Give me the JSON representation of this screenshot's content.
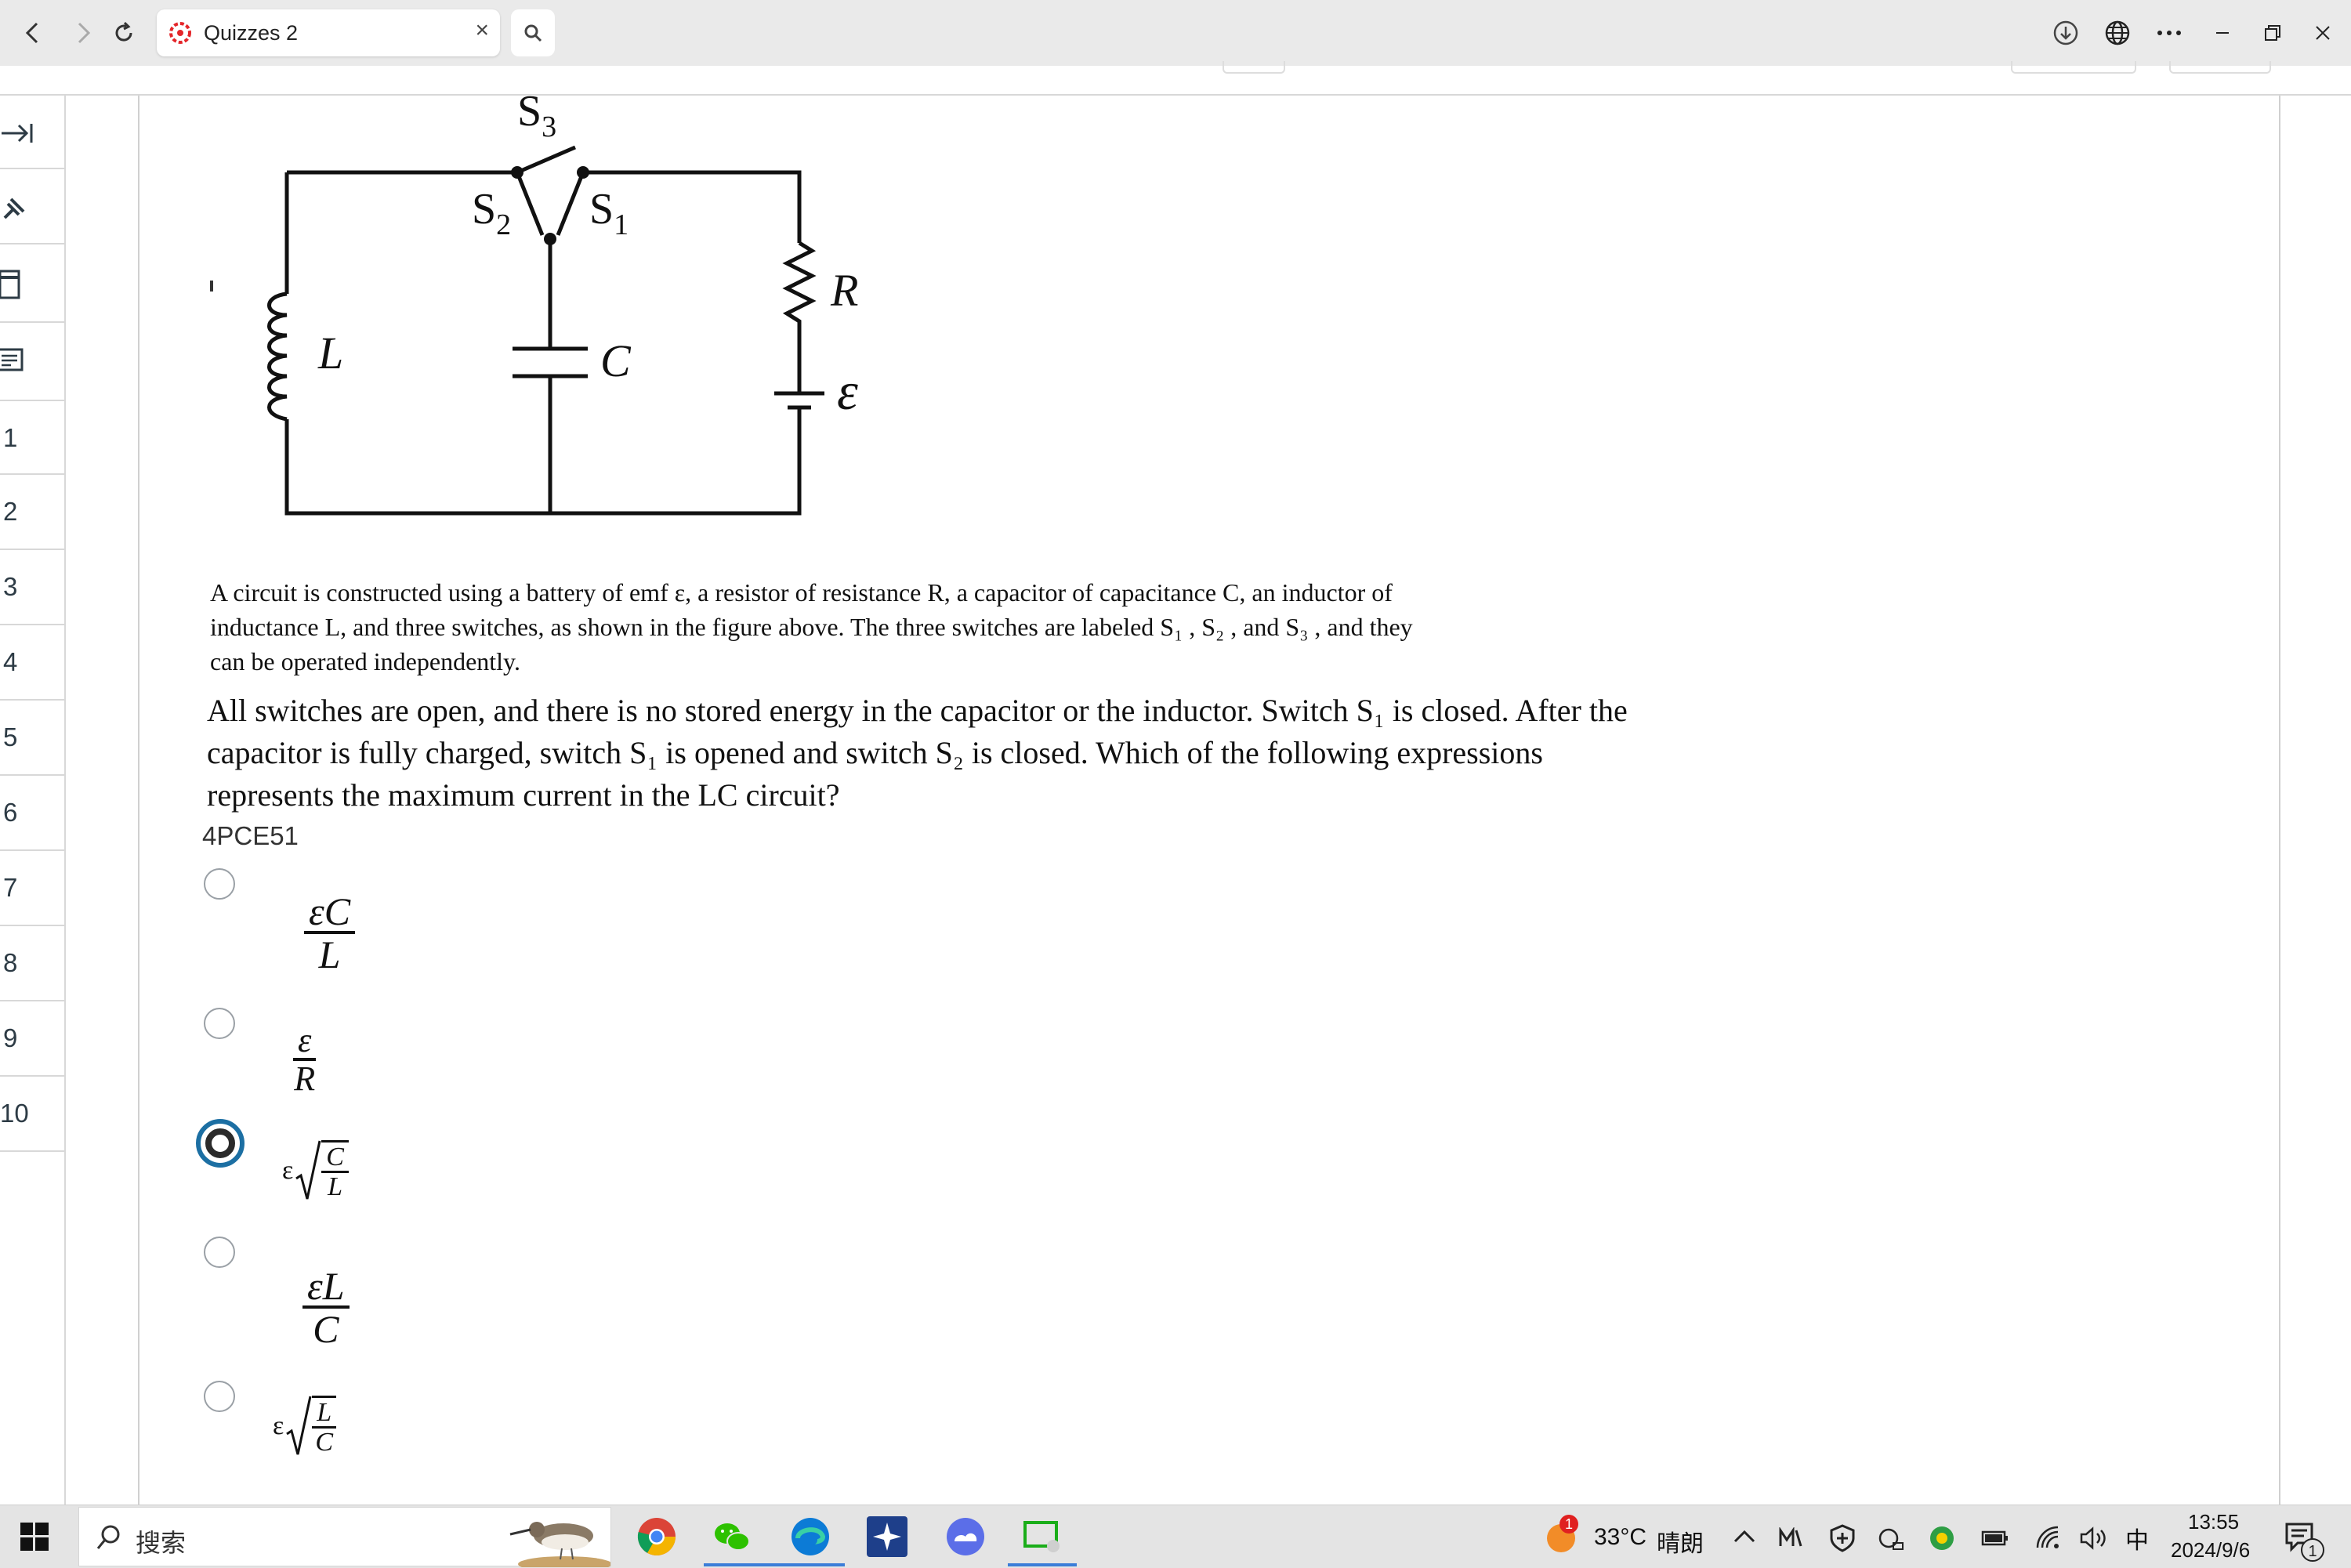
{
  "browser": {
    "tab_title": "Quizzes 2",
    "tab_close": "×"
  },
  "sidebar": {
    "numbers": [
      "1",
      "2",
      "3",
      "4",
      "5",
      "6",
      "7",
      "8",
      "9",
      "10"
    ]
  },
  "figure": {
    "labels": {
      "s1": "S",
      "s1_sub": "1",
      "s2": "S",
      "s2_sub": "2",
      "s3": "S",
      "s3_sub": "3",
      "inductor": "L",
      "capacitor": "C",
      "resistor": "R",
      "emf": "ε"
    }
  },
  "question": {
    "intro_lines": [
      "A circuit is constructed using a battery of emf ε, a resistor of resistance R, a capacitor of capacitance C, an inductor of",
      "inductance L, and three switches, as shown in the figure above. The three switches are labeled S₁ , S₂ , and S₃ , and they",
      "can be operated independently."
    ],
    "body_lines": [
      "All switches are open, and there is no stored energy in the capacitor or the inductor. Switch S₁ is closed. After the",
      "capacitor is fully charged, switch S₁ is opened and switch S₂ is closed. Which of the following expressions",
      "represents the maximum current in the LC circuit?"
    ],
    "id": "4PCE51"
  },
  "answers": {
    "a": {
      "num": "εC",
      "den": "L"
    },
    "b": {
      "num": "ε",
      "den": "R"
    },
    "c": {
      "prefix": "ε",
      "num": "C",
      "den": "L"
    },
    "d": {
      "num": "εL",
      "den": "C"
    },
    "e": {
      "prefix": "ε",
      "num": "L",
      "den": "C"
    },
    "selected_index": 2
  },
  "taskbar": {
    "search_placeholder": "搜索",
    "weather_temp": "33°C",
    "weather_text": "晴朗",
    "weather_badge": "1",
    "ime": "中",
    "time": "13:55",
    "date": "2024/9/6",
    "notification_count": "1"
  }
}
